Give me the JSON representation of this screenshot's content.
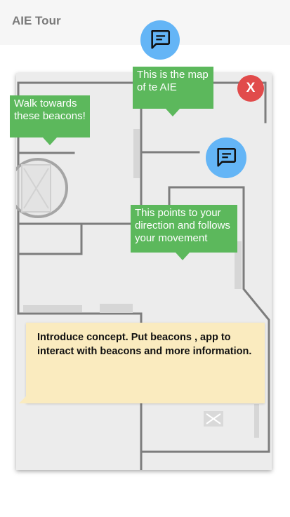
{
  "header": {
    "title": "AIE Tour"
  },
  "close": {
    "label": "X"
  },
  "tooltips": {
    "map": "This is the map of te AIE",
    "beacons": "Walk towards these beacons!",
    "direction": "This points to your direction and follows your movement"
  },
  "note": {
    "text": "Introduce concept. Put beacons , app to interact with beacons and more information."
  },
  "icons": {
    "chat": "chat-bubble-icon",
    "close": "close-icon",
    "beacon": "beacon-placeholder-icon"
  },
  "colors": {
    "header_bg": "#f6f6f6",
    "accent_blue": "#64b5f6",
    "tooltip_green": "#5cb85c",
    "close_red": "#e14b4b",
    "note_bg": "#faebbf",
    "map_bg": "#ececec",
    "wall": "#7d7d7d"
  }
}
